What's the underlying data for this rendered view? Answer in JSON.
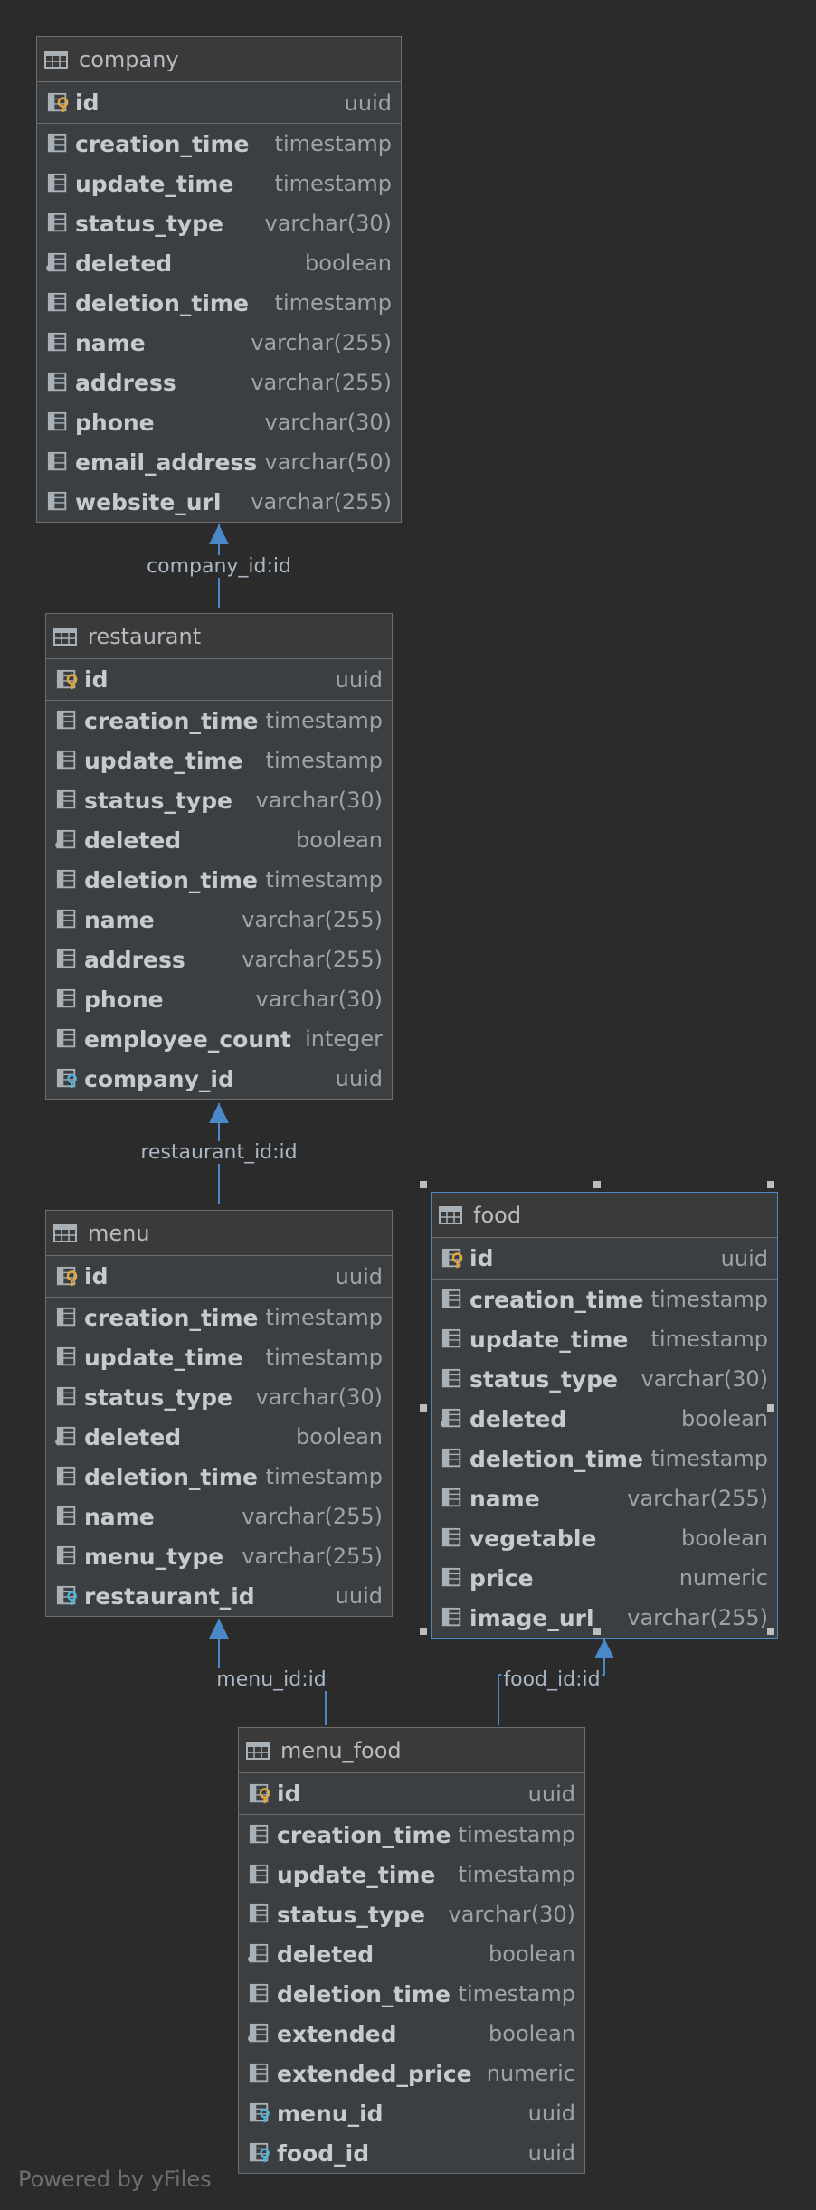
{
  "tables": [
    {
      "name": "company",
      "columns": [
        {
          "name": "id",
          "type": "uuid",
          "kind": "pk"
        },
        {
          "name": "creation_time",
          "type": "timestamp",
          "kind": "col"
        },
        {
          "name": "update_time",
          "type": "timestamp",
          "kind": "col"
        },
        {
          "name": "status_type",
          "type": "varchar(30)",
          "kind": "col"
        },
        {
          "name": "deleted",
          "type": "boolean",
          "kind": "bool"
        },
        {
          "name": "deletion_time",
          "type": "timestamp",
          "kind": "col"
        },
        {
          "name": "name",
          "type": "varchar(255)",
          "kind": "col"
        },
        {
          "name": "address",
          "type": "varchar(255)",
          "kind": "col"
        },
        {
          "name": "phone",
          "type": "varchar(30)",
          "kind": "col"
        },
        {
          "name": "email_address",
          "type": "varchar(50)",
          "kind": "col"
        },
        {
          "name": "website_url",
          "type": "varchar(255)",
          "kind": "col"
        }
      ]
    },
    {
      "name": "restaurant",
      "columns": [
        {
          "name": "id",
          "type": "uuid",
          "kind": "pk"
        },
        {
          "name": "creation_time",
          "type": "timestamp",
          "kind": "col"
        },
        {
          "name": "update_time",
          "type": "timestamp",
          "kind": "col"
        },
        {
          "name": "status_type",
          "type": "varchar(30)",
          "kind": "col"
        },
        {
          "name": "deleted",
          "type": "boolean",
          "kind": "bool"
        },
        {
          "name": "deletion_time",
          "type": "timestamp",
          "kind": "col"
        },
        {
          "name": "name",
          "type": "varchar(255)",
          "kind": "col"
        },
        {
          "name": "address",
          "type": "varchar(255)",
          "kind": "col"
        },
        {
          "name": "phone",
          "type": "varchar(30)",
          "kind": "col"
        },
        {
          "name": "employee_count",
          "type": "integer",
          "kind": "col"
        },
        {
          "name": "company_id",
          "type": "uuid",
          "kind": "fk"
        }
      ]
    },
    {
      "name": "menu",
      "columns": [
        {
          "name": "id",
          "type": "uuid",
          "kind": "pk"
        },
        {
          "name": "creation_time",
          "type": "timestamp",
          "kind": "col"
        },
        {
          "name": "update_time",
          "type": "timestamp",
          "kind": "col"
        },
        {
          "name": "status_type",
          "type": "varchar(30)",
          "kind": "col"
        },
        {
          "name": "deleted",
          "type": "boolean",
          "kind": "bool"
        },
        {
          "name": "deletion_time",
          "type": "timestamp",
          "kind": "col"
        },
        {
          "name": "name",
          "type": "varchar(255)",
          "kind": "col"
        },
        {
          "name": "menu_type",
          "type": "varchar(255)",
          "kind": "col"
        },
        {
          "name": "restaurant_id",
          "type": "uuid",
          "kind": "fk"
        }
      ]
    },
    {
      "name": "food",
      "selected": true,
      "columns": [
        {
          "name": "id",
          "type": "uuid",
          "kind": "pk"
        },
        {
          "name": "creation_time",
          "type": "timestamp",
          "kind": "col"
        },
        {
          "name": "update_time",
          "type": "timestamp",
          "kind": "col"
        },
        {
          "name": "status_type",
          "type": "varchar(30)",
          "kind": "col"
        },
        {
          "name": "deleted",
          "type": "boolean",
          "kind": "bool"
        },
        {
          "name": "deletion_time",
          "type": "timestamp",
          "kind": "col"
        },
        {
          "name": "name",
          "type": "varchar(255)",
          "kind": "col"
        },
        {
          "name": "vegetable",
          "type": "boolean",
          "kind": "col"
        },
        {
          "name": "price",
          "type": "numeric",
          "kind": "col"
        },
        {
          "name": "image_url",
          "type": "varchar(255)",
          "kind": "col"
        }
      ]
    },
    {
      "name": "menu_food",
      "columns": [
        {
          "name": "id",
          "type": "uuid",
          "kind": "pk"
        },
        {
          "name": "creation_time",
          "type": "timestamp",
          "kind": "col"
        },
        {
          "name": "update_time",
          "type": "timestamp",
          "kind": "col"
        },
        {
          "name": "status_type",
          "type": "varchar(30)",
          "kind": "col"
        },
        {
          "name": "deleted",
          "type": "boolean",
          "kind": "bool"
        },
        {
          "name": "deletion_time",
          "type": "timestamp",
          "kind": "col"
        },
        {
          "name": "extended",
          "type": "boolean",
          "kind": "bool"
        },
        {
          "name": "extended_price",
          "type": "numeric",
          "kind": "col"
        },
        {
          "name": "menu_id",
          "type": "uuid",
          "kind": "fk"
        },
        {
          "name": "food_id",
          "type": "uuid",
          "kind": "fk"
        }
      ]
    }
  ],
  "relations": [
    {
      "label": "company_id:id",
      "from": "restaurant",
      "to": "company"
    },
    {
      "label": "restaurant_id:id",
      "from": "menu",
      "to": "restaurant"
    },
    {
      "label": "menu_id:id",
      "from": "menu_food",
      "to": "menu"
    },
    {
      "label": "food_id:id",
      "from": "menu_food",
      "to": "food"
    }
  ],
  "footer": "Powered by yFiles",
  "colors": {
    "background": "#2b2b2b",
    "table_body": "#3c3f41",
    "border": "#6d6d6d",
    "selection": "#4a88c7",
    "edge": "#4a88c7",
    "pk_key": "#e6a73a",
    "fk_key": "#4fb3d9"
  }
}
